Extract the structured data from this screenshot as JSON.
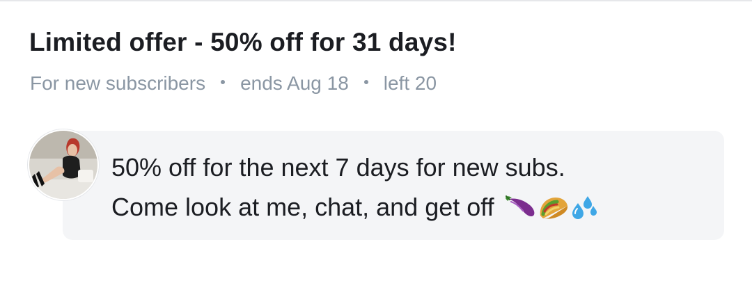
{
  "offer": {
    "title": "Limited offer - 50% off for 31 days!",
    "audience": "For new subscribers",
    "ends": "ends Aug 18",
    "left": "left 20"
  },
  "message": {
    "line1": "50% off for the next 7 days for new subs.",
    "line2": "Come look at me, chat, and get off",
    "emojis": [
      "eggplant-emoji",
      "taco-emoji",
      "sweat-droplets-emoji"
    ]
  },
  "colors": {
    "title": "#1b1d22",
    "meta": "#8a96a3",
    "bubble": "#f4f5f7"
  }
}
